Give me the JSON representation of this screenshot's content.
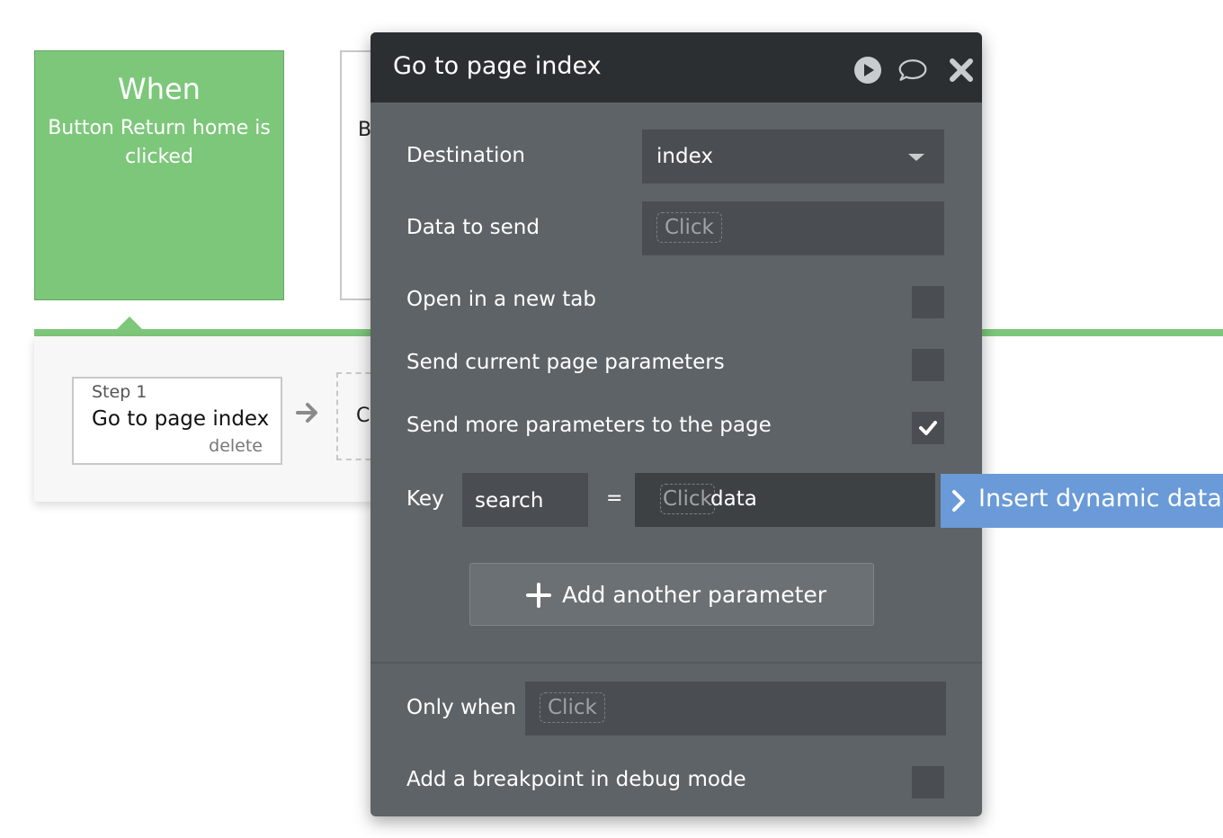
{
  "canvas": {
    "event_title": "When",
    "event_desc": "Button Return home is clicked",
    "second_event_clip": "B",
    "step": {
      "number": "Step 1",
      "name": "Go to page index",
      "delete": "delete"
    },
    "next_step_clip": "C"
  },
  "modal": {
    "title": "Go to page index",
    "destination": {
      "label": "Destination",
      "value": "index"
    },
    "data_to_send": {
      "label": "Data to send",
      "placeholder": "Click"
    },
    "open_new_tab": {
      "label": "Open in a new tab",
      "checked": false
    },
    "send_current": {
      "label": "Send current page parameters",
      "checked": false
    },
    "send_more": {
      "label": "Send more parameters to the page",
      "checked": true
    },
    "key_row": {
      "label": "Key",
      "key_value": "search",
      "equals": "=",
      "value_placeholder": "Click",
      "value_typed": "data"
    },
    "add_param_label": "Add another parameter",
    "only_when": {
      "label": "Only when",
      "placeholder": "Click"
    },
    "breakpoint": {
      "label": "Add a breakpoint in debug mode",
      "checked": false
    }
  },
  "insert_dynamic": {
    "label": "Insert dynamic data"
  },
  "colors": {
    "event_green": "#7dc77a",
    "modal_bg": "#5e6367",
    "modal_header": "#2b2f32",
    "insert_blue": "#6a9ad8"
  },
  "icons": [
    "play-icon",
    "comment-icon",
    "close-icon",
    "arrow-right-icon",
    "checkmark-icon",
    "plus-icon",
    "chevron-right-icon",
    "caret-down-icon"
  ]
}
